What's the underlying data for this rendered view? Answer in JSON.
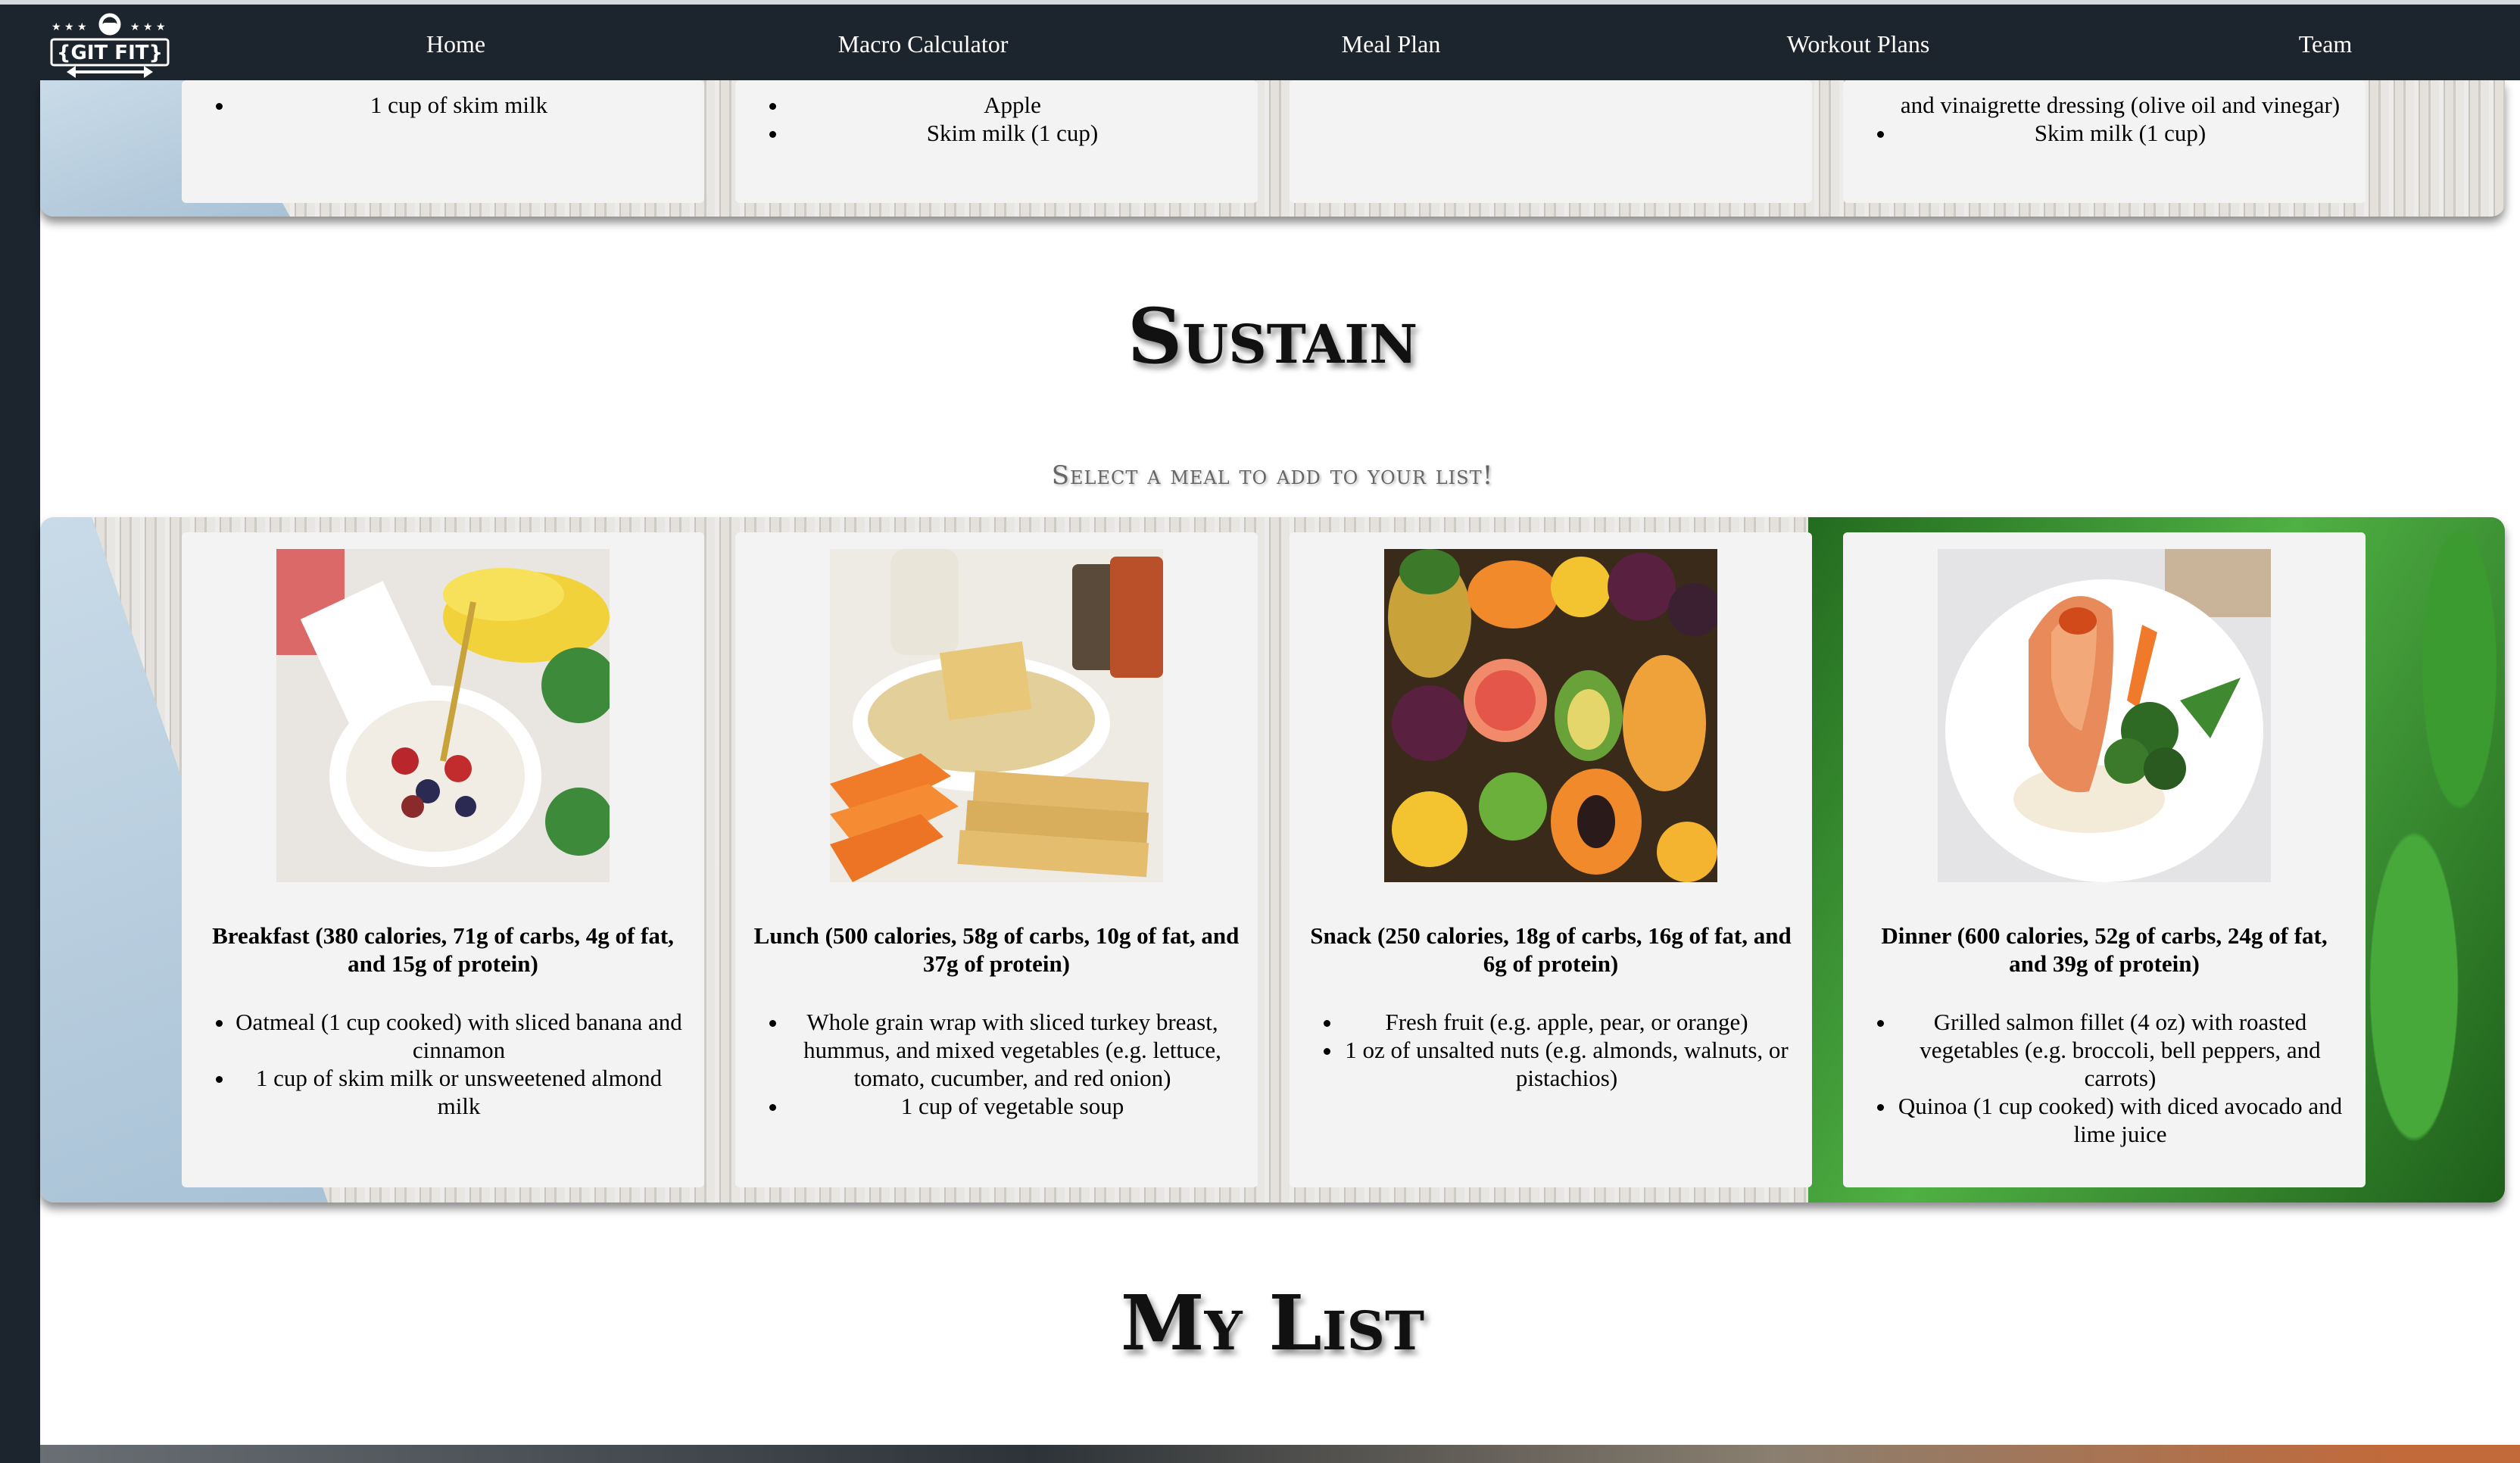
{
  "nav": {
    "logo_text": "{GIT FIT}",
    "items": [
      "Home",
      "Macro Calculator",
      "Meal Plan",
      "Workout Plans",
      "Team"
    ]
  },
  "previous_cards": [
    {
      "items": [
        "1 cup of skim milk"
      ]
    },
    {
      "items": [
        "Apple",
        "Skim milk (1 cup)"
      ]
    },
    {
      "items": []
    },
    {
      "items": [
        "and vinaigrette dressing (olive oil and vinegar)",
        "Skim milk (1 cup)"
      ]
    }
  ],
  "sustain": {
    "title": "Sustain",
    "subtitle": "Select a meal to add to your list!",
    "meals": [
      {
        "title": "Breakfast (380 calories, 71g of carbs, 4g of fat, and 15g of protein)",
        "items": [
          "Oatmeal (1 cup cooked) with sliced banana and cinnamon",
          "1 cup of skim milk or unsweetened almond milk"
        ],
        "image_icon": "oatmeal-bowl-photo"
      },
      {
        "title": "Lunch (500 calories, 58g of carbs, 10g of fat, and 37g of protein)",
        "items": [
          "Whole grain wrap with sliced turkey breast, hummus, and mixed vegetables (e.g. lettuce, tomato, cucumber, and red onion)",
          "1 cup of vegetable soup"
        ],
        "image_icon": "hummus-crackers-photo"
      },
      {
        "title": "Snack (250 calories, 18g of carbs, 16g of fat, and 6g of protein)",
        "items": [
          "Fresh fruit (e.g. apple, pear, or orange)",
          "1 oz of unsalted nuts (e.g. almonds, walnuts, or pistachios)"
        ],
        "image_icon": "fruit-assortment-photo"
      },
      {
        "title": "Dinner (600 calories, 52g of carbs, 24g of fat, and 39g of protein)",
        "items": [
          "Grilled salmon fillet (4 oz) with roasted vegetables (e.g. broccoli, bell peppers, and carrots)",
          "Quinoa (1 cup cooked) with diced avocado and lime juice"
        ],
        "image_icon": "salmon-plate-photo"
      }
    ]
  },
  "my_list": {
    "title": "My List"
  },
  "colors": {
    "navbar": "#1c252e",
    "card": "#f3f3f3",
    "page": "#ffffff"
  }
}
